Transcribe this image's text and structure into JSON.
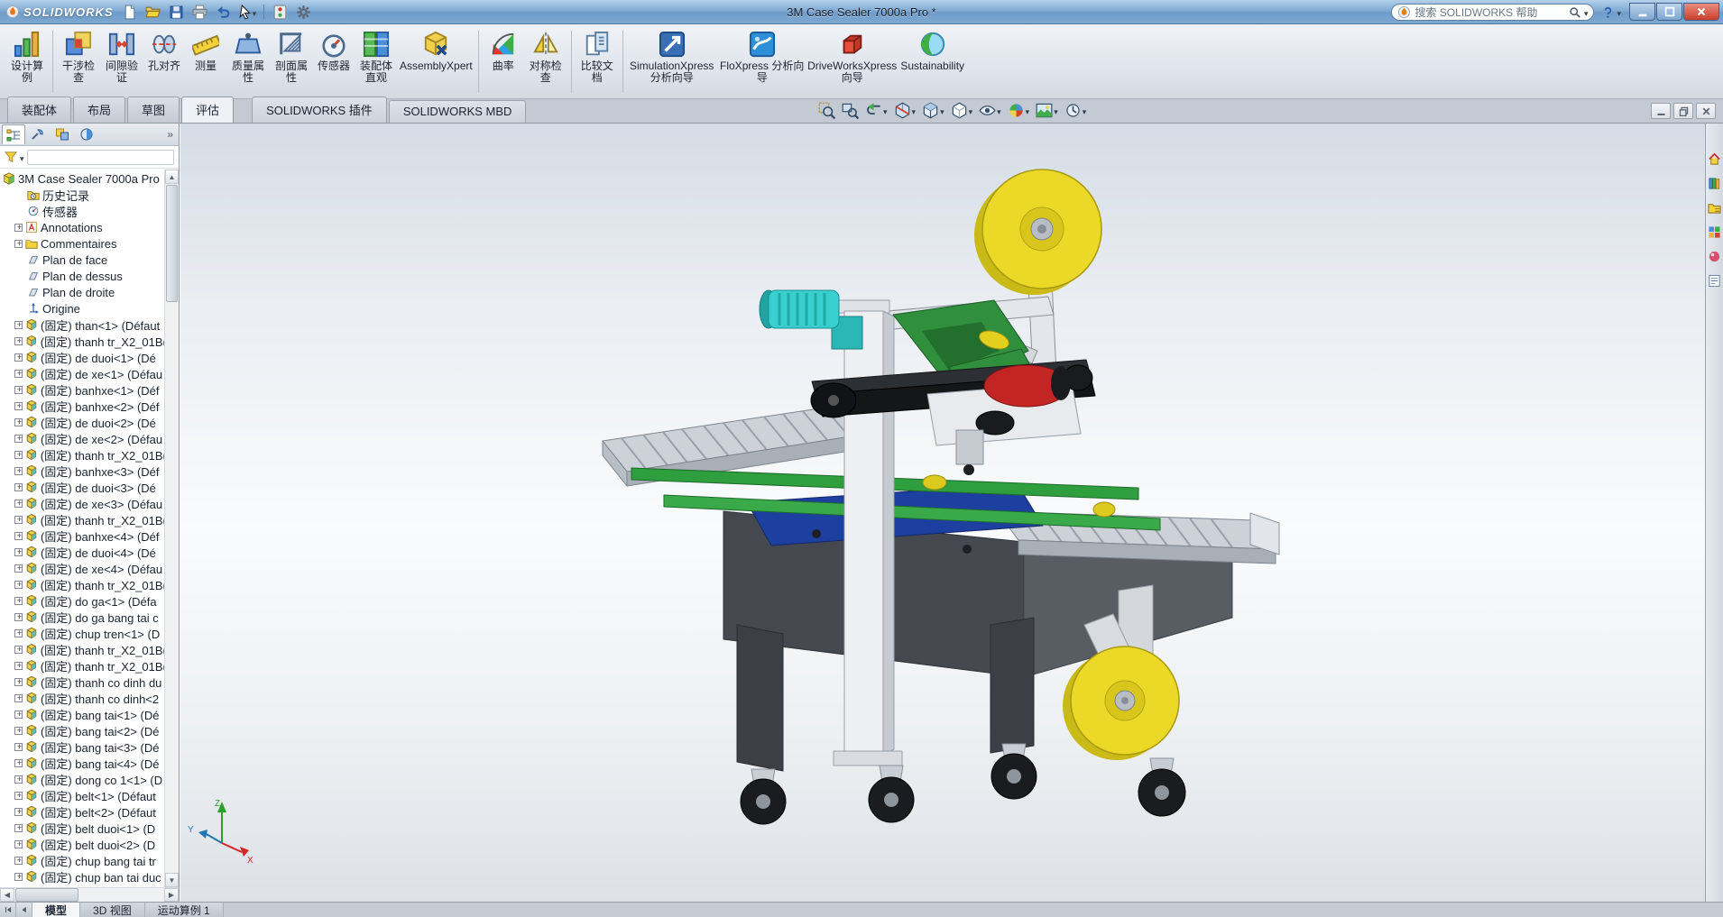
{
  "titlebar": {
    "logo": "SOLIDWORKS",
    "title": "3M Case Sealer 7000a Pro *",
    "search_placeholder": "搜索 SOLIDWORKS 帮助",
    "quick_icons": [
      "new-doc",
      "open",
      "save",
      "print",
      "undo",
      "select-cursor",
      "separator",
      "rebuild",
      "options"
    ],
    "window_buttons": [
      "minimize",
      "maximize",
      "close"
    ]
  },
  "ribbon": {
    "groups": [
      {
        "buttons": [
          {
            "label": "设计算例",
            "icon": "study"
          }
        ]
      },
      {
        "buttons": [
          {
            "label": "干涉检查",
            "icon": "interference"
          },
          {
            "label": "间隙验证",
            "icon": "clearance"
          },
          {
            "label": "孔对齐",
            "icon": "hole-align"
          },
          {
            "label": "测量",
            "icon": "measure"
          },
          {
            "label": "质量属性",
            "icon": "mass"
          },
          {
            "label": "剖面属性",
            "icon": "section-props"
          },
          {
            "label": "传感器",
            "icon": "sensor"
          },
          {
            "label": "装配体直观",
            "icon": "visualize"
          },
          {
            "label": "AssemblyXpert",
            "icon": "assembly-xpert"
          }
        ]
      },
      {
        "buttons": [
          {
            "label": "曲率",
            "icon": "curvature"
          },
          {
            "label": "对称检查",
            "icon": "symmetry"
          }
        ]
      },
      {
        "buttons": [
          {
            "label": "比较文档",
            "icon": "compare"
          }
        ]
      },
      {
        "buttons": [
          {
            "label": "SimulationXpress 分析向导",
            "icon": "simulationxpress"
          },
          {
            "label": "FloXpress 分析向导",
            "icon": "floxpress"
          },
          {
            "label": "DriveWorksXpress 向导",
            "icon": "driveworksxpress"
          },
          {
            "label": "Sustainability",
            "icon": "sustainability"
          }
        ]
      }
    ]
  },
  "tabs": {
    "items": [
      "装配体",
      "布局",
      "草图",
      "评估"
    ],
    "active_index": 3,
    "addins": [
      "SOLIDWORKS 插件",
      "SOLIDWORKS MBD"
    ]
  },
  "doc_window_buttons": [
    "doc-min",
    "doc-restore",
    "doc-close"
  ],
  "headsup": {
    "icons": [
      {
        "icon": "zoom-fit",
        "caret": false
      },
      {
        "icon": "zoom-area",
        "caret": false
      },
      {
        "icon": "previous-view",
        "caret": true
      },
      {
        "icon": "section-view",
        "caret": true
      },
      {
        "icon": "view-orientation",
        "caret": true
      },
      {
        "icon": "display-style",
        "caret": true
      },
      {
        "icon": "hide-show",
        "caret": true
      },
      {
        "icon": "edit-appearance",
        "caret": true
      },
      {
        "icon": "scene",
        "caret": true
      },
      {
        "icon": "view-settings",
        "caret": true
      }
    ]
  },
  "sidebar": {
    "manager_tabs": [
      "featuremanager",
      "propertymanager",
      "configurationmanager",
      "displaymanager"
    ],
    "overflow_chevrons": "»"
  },
  "feature_tree": {
    "root": {
      "label": "3M Case Sealer 7000a Pro",
      "icon": "asm-root"
    },
    "items": [
      {
        "label": "历史记录",
        "icon": "history",
        "expandable": false
      },
      {
        "label": "传感器",
        "icon": "sensor-tree",
        "expandable": false
      },
      {
        "label": "Annotations",
        "icon": "annotations",
        "expandable": true
      },
      {
        "label": "Commentaires",
        "icon": "folder",
        "expandable": true
      },
      {
        "label": "Plan de face",
        "icon": "plane",
        "expandable": false
      },
      {
        "label": "Plan de dessus",
        "icon": "plane",
        "expandable": false
      },
      {
        "label": "Plan de droite",
        "icon": "plane",
        "expandable": false
      },
      {
        "label": "Origine",
        "icon": "origin",
        "expandable": false
      },
      {
        "label": "(固定) than<1> (Défaut",
        "icon": "part",
        "expandable": true
      },
      {
        "label": "(固定) thanh tr_X2_01B(",
        "icon": "part",
        "expandable": true
      },
      {
        "label": "(固定) de duoi<1> (Dé",
        "icon": "part",
        "expandable": true
      },
      {
        "label": "(固定) de xe<1> (Défau",
        "icon": "part",
        "expandable": true
      },
      {
        "label": "(固定) banhxe<1> (Déf",
        "icon": "part",
        "expandable": true
      },
      {
        "label": "(固定) banhxe<2> (Déf",
        "icon": "part",
        "expandable": true
      },
      {
        "label": "(固定) de duoi<2> (Dé",
        "icon": "part",
        "expandable": true
      },
      {
        "label": "(固定) de xe<2> (Défau",
        "icon": "part",
        "expandable": true
      },
      {
        "label": "(固定) thanh tr_X2_01B(",
        "icon": "part",
        "expandable": true
      },
      {
        "label": "(固定) banhxe<3> (Déf",
        "icon": "part",
        "expandable": true
      },
      {
        "label": "(固定) de duoi<3> (Dé",
        "icon": "part",
        "expandable": true
      },
      {
        "label": "(固定) de xe<3> (Défau",
        "icon": "part",
        "expandable": true
      },
      {
        "label": "(固定) thanh tr_X2_01B(",
        "icon": "part",
        "expandable": true
      },
      {
        "label": "(固定) banhxe<4> (Déf",
        "icon": "part",
        "expandable": true
      },
      {
        "label": "(固定) de duoi<4> (Dé",
        "icon": "part",
        "expandable": true
      },
      {
        "label": "(固定) de xe<4> (Défau",
        "icon": "part",
        "expandable": true
      },
      {
        "label": "(固定) thanh tr_X2_01B(",
        "icon": "part",
        "expandable": true
      },
      {
        "label": "(固定) do ga<1> (Défa",
        "icon": "part",
        "expandable": true
      },
      {
        "label": "(固定) do ga bang tai c",
        "icon": "part",
        "expandable": true
      },
      {
        "label": "(固定) chup tren<1> (D",
        "icon": "part",
        "expandable": true
      },
      {
        "label": "(固定) thanh tr_X2_01B(",
        "icon": "part",
        "expandable": true
      },
      {
        "label": "(固定) thanh tr_X2_01B(",
        "icon": "part",
        "expandable": true
      },
      {
        "label": "(固定) thanh co dinh du",
        "icon": "part",
        "expandable": true
      },
      {
        "label": "(固定) thanh co dinh<2",
        "icon": "part",
        "expandable": true
      },
      {
        "label": "(固定) bang tai<1> (Dé",
        "icon": "part",
        "expandable": true
      },
      {
        "label": "(固定) bang tai<2> (Dé",
        "icon": "part",
        "expandable": true
      },
      {
        "label": "(固定) bang tai<3> (Dé",
        "icon": "part",
        "expandable": true
      },
      {
        "label": "(固定) bang tai<4> (Dé",
        "icon": "part",
        "expandable": true
      },
      {
        "label": "(固定) dong co 1<1> (D",
        "icon": "part",
        "expandable": true
      },
      {
        "label": "(固定) belt<1> (Défaut",
        "icon": "part",
        "expandable": true
      },
      {
        "label": "(固定) belt<2> (Défaut",
        "icon": "part",
        "expandable": true
      },
      {
        "label": "(固定) belt duoi<1> (D",
        "icon": "part",
        "expandable": true
      },
      {
        "label": "(固定) belt duoi<2> (D",
        "icon": "part",
        "expandable": true
      },
      {
        "label": "(固定) chup bang tai tr",
        "icon": "part",
        "expandable": true
      },
      {
        "label": "(固定) chup ban tai duc",
        "icon": "part",
        "expandable": true
      }
    ]
  },
  "viewport": {
    "triad": {
      "x": "X",
      "y": "Y",
      "z": "Z"
    }
  },
  "model_colors": {
    "tape_reel_yellow": "#ecd827",
    "frame_green": "#2f8f3c",
    "motor_cyan": "#39cfcf",
    "roller_red": "#c32525",
    "body_gray": "#45494f",
    "deck_blue": "#1d3f9f",
    "structure_light_gray": "#e3e6ea"
  },
  "taskpane": {
    "icons": [
      "resources-home",
      "design-library",
      "file-explorer",
      "view-palette",
      "appearances",
      "custom-properties"
    ]
  },
  "bottombar": {
    "nav_icons": [
      "tab-first",
      "tab-prev"
    ],
    "tabs": [
      "模型",
      "3D 视图",
      "运动算例 1"
    ],
    "active_index": 0
  }
}
